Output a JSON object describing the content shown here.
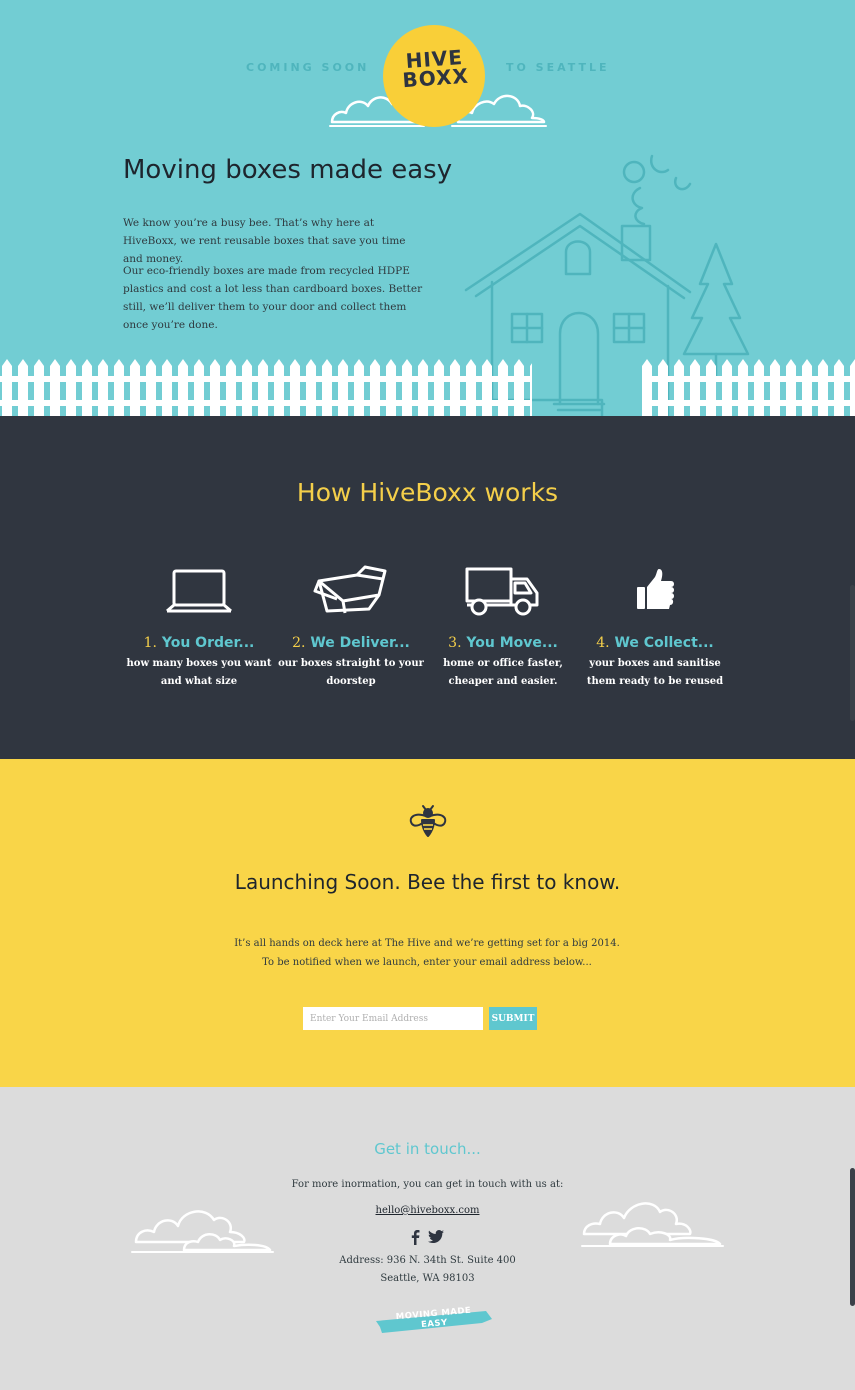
{
  "hero": {
    "tagline_left": "COMING SOON",
    "tagline_right": "TO SEATTLE",
    "logo_line1": "HIVE",
    "logo_line2": "BOXX",
    "title": "Moving boxes made easy",
    "paragraphs": [
      "We know you’re a busy bee. That’s why here at HiveBoxx, we rent reusable boxes that save you time and money.",
      "Our eco-friendly boxes are made from recycled HDPE plastics and cost a lot less than cardboard boxes. Better still, we’ll deliver them to your door and collect them once you’re done."
    ]
  },
  "how": {
    "title": "How HiveBoxx works",
    "steps": [
      {
        "num": "1.",
        "title": "You Order...",
        "desc": "how many boxes you want and what size",
        "icon": "laptop-icon"
      },
      {
        "num": "2.",
        "title": "We Deliver...",
        "desc": "our boxes straight to your doorstep",
        "icon": "box-icon"
      },
      {
        "num": "3.",
        "title": "You Move...",
        "desc": "home or office faster, cheaper and easier.",
        "icon": "truck-icon"
      },
      {
        "num": "4.",
        "title": "We Collect...",
        "desc": "your boxes and sanitise them ready to be reused",
        "icon": "thumbs-up-icon"
      }
    ]
  },
  "launch": {
    "title": "Launching Soon. Bee the first to know.",
    "text": "It’s all hands on deck here at The Hive and we’re getting set for a big 2014. To be notified when we launch, enter your email address below...",
    "email_placeholder": "Enter Your Email Address",
    "email_value": "",
    "submit_label": "SUBMIT",
    "icon": "bee-icon"
  },
  "contact": {
    "title": "Get in touch...",
    "intro": "For more inormation, you can get in touch with us at:",
    "email": "hello@hiveboxx.com",
    "address_line1": "Address: 936 N. 34th St. Suite 400",
    "address_line2": "Seattle, WA 98103",
    "ribbon": "MOVING MADE EASY",
    "social_icons": [
      "facebook-icon",
      "twitter-icon"
    ]
  },
  "colors": {
    "teal_bg": "#72cdd3",
    "dark_bg": "#303640",
    "yellow_bg": "#f9d548",
    "grey_bg": "#dcdcdc",
    "accent_teal": "#5fc7cf",
    "accent_yellow": "#f4cf4a"
  }
}
